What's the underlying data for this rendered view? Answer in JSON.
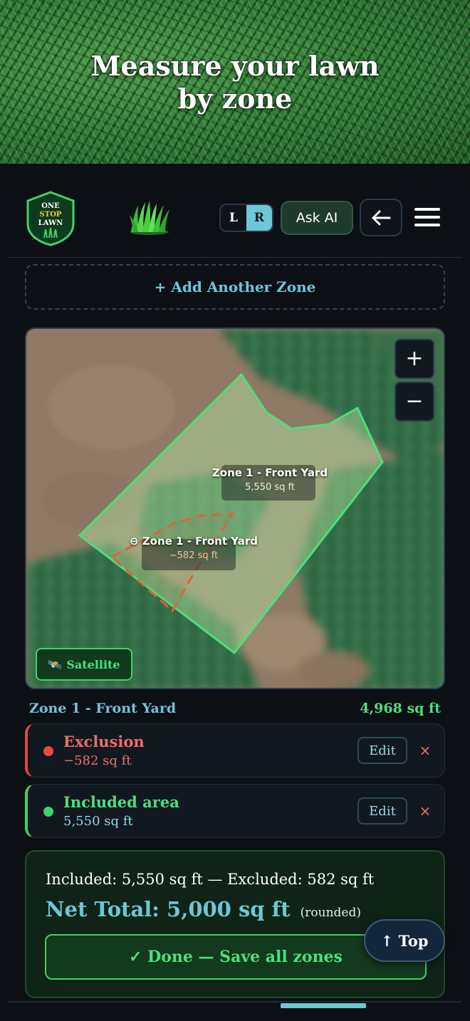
{
  "hero": {
    "title": "Measure your lawn by zone"
  },
  "header": {
    "logo": {
      "line1": "ONE",
      "line2": "STOP",
      "line3": "LAWN"
    },
    "lr_toggle": {
      "left": "L",
      "right": "R",
      "active": "R"
    },
    "ask_ai_label": "Ask AI",
    "back_icon": "arrow-left-icon",
    "menu_icon": "hamburger-menu-icon"
  },
  "add_zone_label": "+ Add Another Zone",
  "map": {
    "zoom_in": "+",
    "zoom_out": "−",
    "main_label": {
      "name": "Zone 1 - Front Yard",
      "area": "5,550 sq ft"
    },
    "exclusion_label": {
      "name": "⊖ Zone 1 - Front Yard",
      "area": "−582 sq ft"
    },
    "satellite_button": {
      "icon": "🛰️",
      "label": "Satellite"
    }
  },
  "zone": {
    "name": "Zone 1 - Front Yard",
    "total": "4,968 sq ft",
    "areas": [
      {
        "type": "exclusion",
        "title": "Exclusion",
        "value": "−582 sq ft",
        "edit": "Edit",
        "remove": "×"
      },
      {
        "type": "included",
        "title": "Included area",
        "value": "5,550 sq ft",
        "edit": "Edit",
        "remove": "×"
      }
    ]
  },
  "totals": {
    "summary": "Included: 5,550 sq ft — Excluded: 582 sq ft",
    "net_total": "Net Total: 5,000 sq ft",
    "rounded_note": "(rounded)",
    "done_label": "✓ Done — Save all zones"
  },
  "top_button_label": "↑ Top",
  "colors": {
    "accent_teal": "#6ec6d6",
    "accent_green": "#4be07a",
    "danger_red": "#e84a4a",
    "background": "#0c0f14"
  }
}
